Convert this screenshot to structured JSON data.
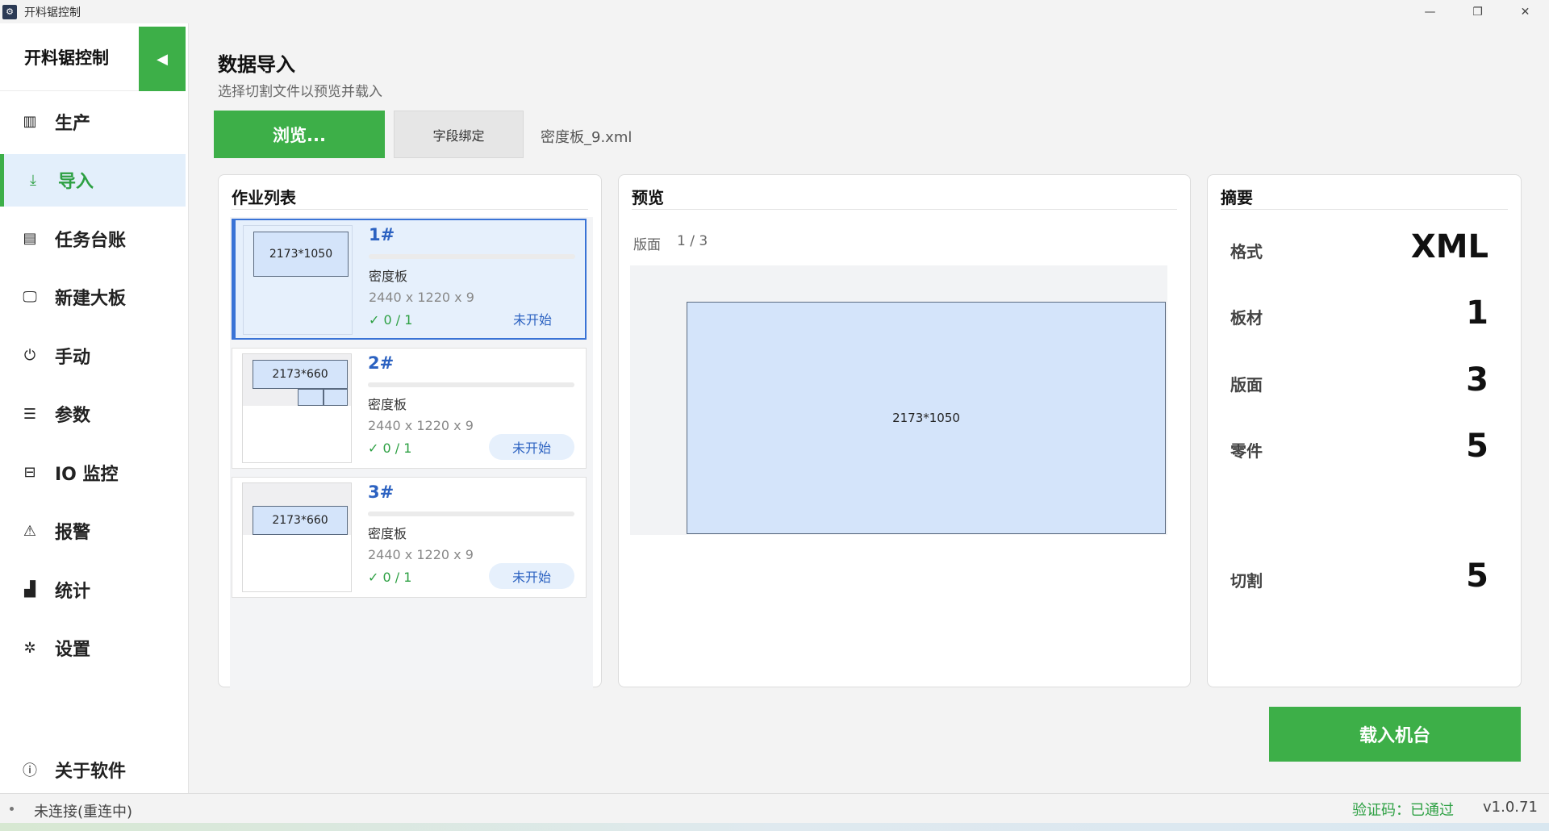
{
  "window": {
    "title": "开料锯控制",
    "minimize_glyph": "—",
    "restore_glyph": "❐",
    "close_glyph": "✕"
  },
  "sidebar": {
    "brand": "开料锯控制",
    "collapse_glyph": "◀",
    "items": [
      {
        "label": "生产",
        "icon": "columns-icon",
        "glyph": "▥"
      },
      {
        "label": "导入",
        "icon": "download-icon",
        "glyph": "⤓"
      },
      {
        "label": "任务台账",
        "icon": "ledger-icon",
        "glyph": "▤"
      },
      {
        "label": "新建大板",
        "icon": "monitor-icon",
        "glyph": "🖵"
      },
      {
        "label": "手动",
        "icon": "power-icon",
        "glyph": "⏻"
      },
      {
        "label": "参数",
        "icon": "sliders-icon",
        "glyph": "☰"
      },
      {
        "label": "IO 监控",
        "icon": "chip-icon",
        "glyph": "⊟"
      },
      {
        "label": "报警",
        "icon": "warning-icon",
        "glyph": "⚠"
      },
      {
        "label": "统计",
        "icon": "bar-chart-icon",
        "glyph": "▟"
      },
      {
        "label": "设置",
        "icon": "gear-icon",
        "glyph": "✲"
      }
    ],
    "about": {
      "label": "关于软件",
      "icon": "info-icon",
      "glyph": "ⓘ"
    }
  },
  "page": {
    "title": "数据导入",
    "subtitle": "选择切割文件以预览并载入",
    "browse_label": "浏览...",
    "bind_label": "字段绑定",
    "file_name": "密度板_9.xml"
  },
  "jobs": {
    "title": "作业列表",
    "items": [
      {
        "num": "1#",
        "part_label": "2173*1050",
        "material": "密度板",
        "dims": "2440 x 1220 x 9",
        "count": "✓ 0 / 1",
        "status": "未开始"
      },
      {
        "num": "2#",
        "part_label": "2173*660",
        "material": "密度板",
        "dims": "2440 x 1220 x 9",
        "count": "✓ 0 / 1",
        "status": "未开始"
      },
      {
        "num": "3#",
        "part_label": "2173*660",
        "material": "密度板",
        "dims": "2440 x 1220 x 9",
        "count": "✓ 0 / 1",
        "status": "未开始"
      }
    ]
  },
  "preview": {
    "title": "预览",
    "face_label": "版面",
    "face_page": "1 / 3",
    "part_label": "2173*1050"
  },
  "summary": {
    "title": "摘要",
    "rows": [
      {
        "label": "格式",
        "value": "XML"
      },
      {
        "label": "板材",
        "value": "1"
      },
      {
        "label": "版面",
        "value": "3"
      },
      {
        "label": "零件",
        "value": "5"
      },
      {
        "label": "切割",
        "value": "5"
      }
    ]
  },
  "load_button": "载入机台",
  "status": {
    "connection": "未连接(重连中)",
    "verify": "验证码：已通过",
    "version": "v1.0.71"
  },
  "colors": {
    "accent_green": "#3daf48",
    "accent_blue": "#2c62c1",
    "part_fill": "#d4e4fa"
  }
}
